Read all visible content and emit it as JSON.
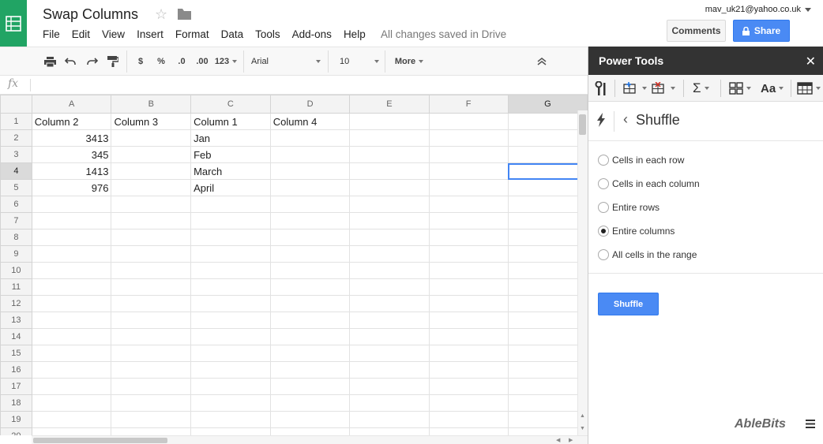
{
  "doc": {
    "title": "Swap Columns",
    "saved_status": "All changes saved in Drive",
    "account": "mav_uk21@yahoo.co.uk"
  },
  "menu": [
    "File",
    "Edit",
    "View",
    "Insert",
    "Format",
    "Data",
    "Tools",
    "Add-ons",
    "Help"
  ],
  "buttons": {
    "comments": "Comments",
    "share": "Share"
  },
  "toolbar": {
    "currency": "$",
    "percent": "%",
    "dec_decrease": ".0",
    "dec_increase": ".00",
    "more_formats": "123",
    "font": "Arial",
    "font_size": "10",
    "more": "More"
  },
  "formula_bar": {
    "fx": "fx"
  },
  "sheet": {
    "columns": [
      "A",
      "B",
      "C",
      "D",
      "E",
      "F",
      "G"
    ],
    "row_numbers": [
      "1",
      "2",
      "3",
      "4",
      "5",
      "6",
      "7",
      "8",
      "9",
      "10",
      "11",
      "12",
      "13",
      "14",
      "15",
      "16",
      "17",
      "18",
      "19",
      "20"
    ],
    "rows": [
      [
        "Column 2",
        "Column 3",
        "Column 1",
        "Column 4",
        "",
        "",
        ""
      ],
      [
        "3413",
        "",
        "Jan",
        "",
        "",
        "",
        ""
      ],
      [
        "345",
        "",
        "Feb",
        "",
        "",
        "",
        ""
      ],
      [
        "1413",
        "",
        "March",
        "",
        "",
        "",
        ""
      ],
      [
        "976",
        "",
        "April",
        "",
        "",
        "",
        ""
      ]
    ],
    "selected_cell": "G4"
  },
  "panel": {
    "title": "Power Tools",
    "section_title": "Shuffle",
    "options": [
      {
        "label": "Cells in each row",
        "checked": false
      },
      {
        "label": "Cells in each column",
        "checked": false
      },
      {
        "label": "Entire rows",
        "checked": false
      },
      {
        "label": "Entire columns",
        "checked": true
      },
      {
        "label": "All cells in the range",
        "checked": false
      }
    ],
    "action_button": "Shuffle",
    "brand": "AbleBits"
  },
  "colors": {
    "sheets_green": "#21a464",
    "accent_blue": "#4a8af4",
    "panel_header": "#333333"
  }
}
